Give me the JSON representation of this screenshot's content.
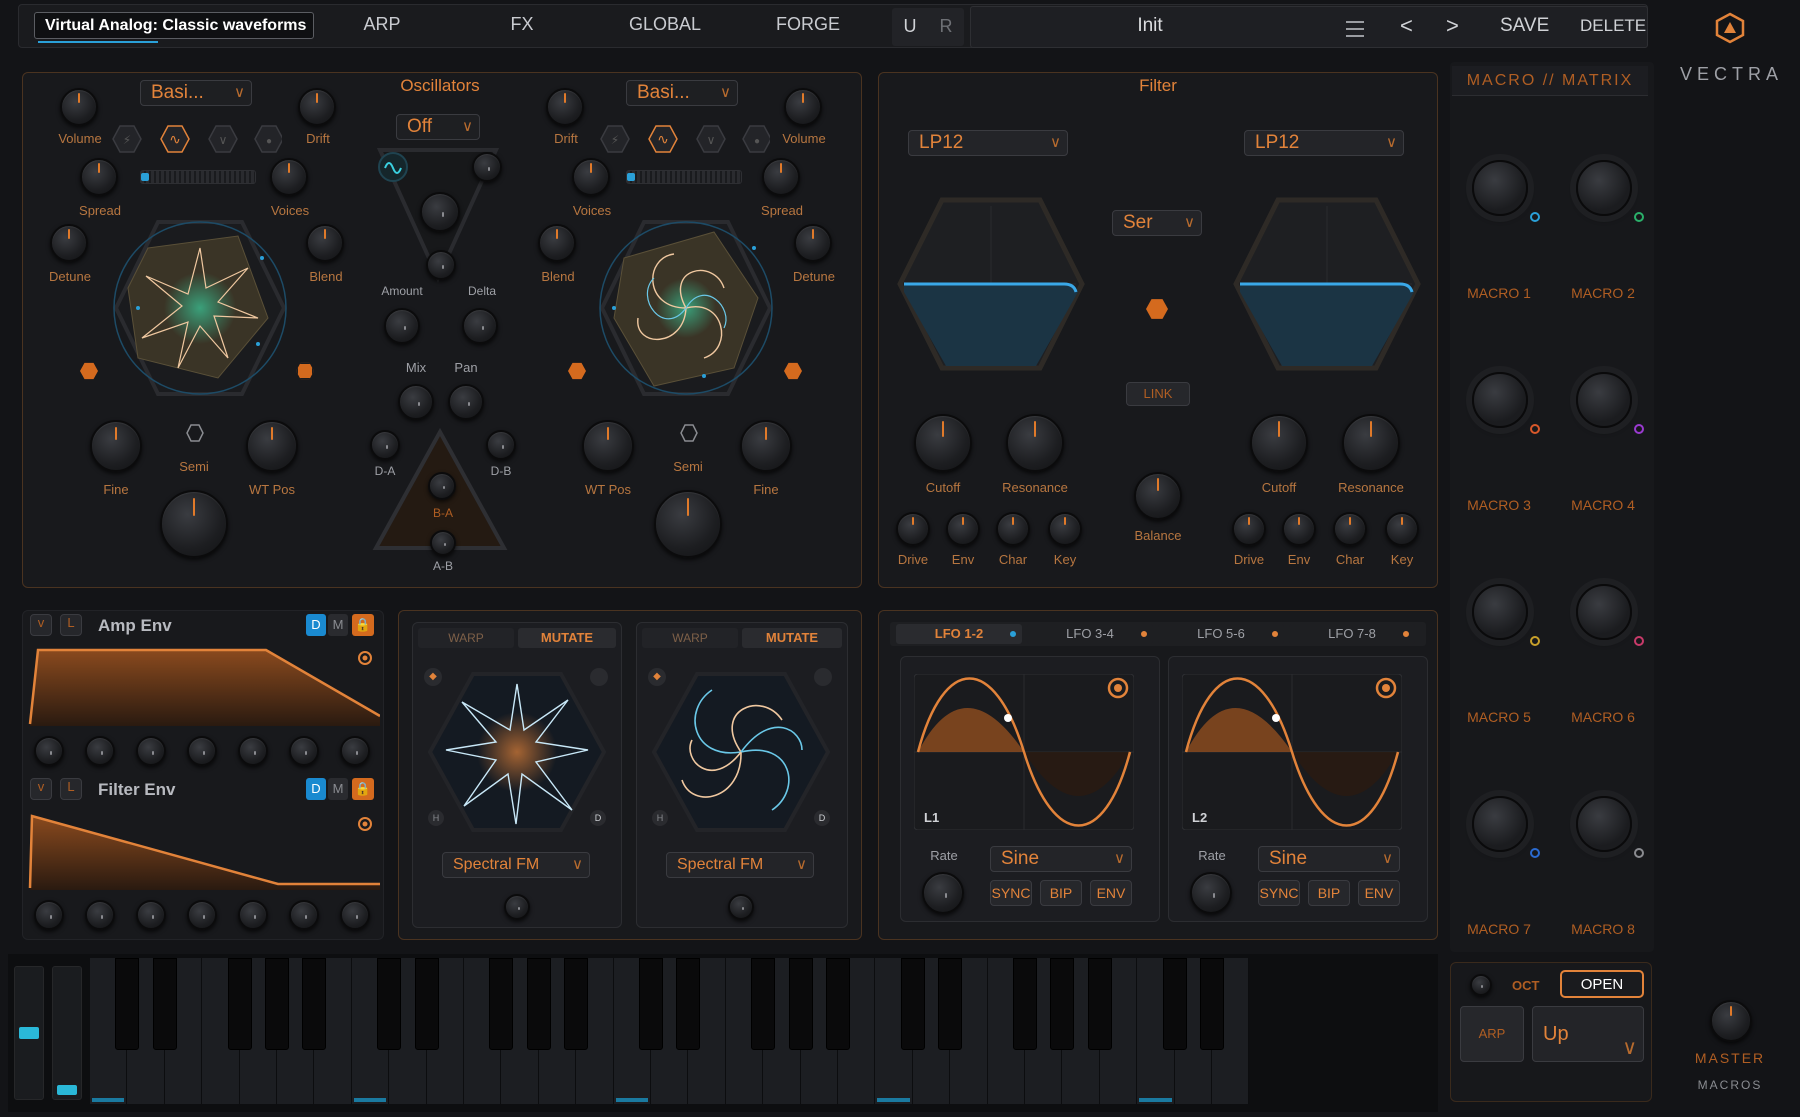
{
  "header": {
    "preset_category": "Virtual Analog: Classic waveforms",
    "tabs": [
      "ARP",
      "FX",
      "GLOBAL",
      "FORGE"
    ],
    "undo_label": "U",
    "redo_label": "R",
    "preset_name": "Init",
    "menu_icon": "hamburger-icon",
    "prev_label": "<",
    "next_label": ">",
    "save_label": "SAVE",
    "delete_label": "DELETE"
  },
  "brand": {
    "name": "VECTRA",
    "logo_icon": "vectra-hex-logo"
  },
  "oscillators": {
    "title": "Oscillators",
    "osc1": {
      "wave_select": "Basi...",
      "labels": {
        "volume": "Volume",
        "drift": "Drift",
        "spread": "Spread",
        "voices": "Voices",
        "detune": "Detune",
        "blend": "Blend",
        "fine": "Fine",
        "semi": "Semi",
        "wtpos": "WT Pos"
      }
    },
    "osc2": {
      "wave_select": "Basi...",
      "labels": {
        "volume": "Volume",
        "drift": "Drift",
        "spread": "Spread",
        "voices": "Voices",
        "detune": "Detune",
        "blend": "Blend",
        "fine": "Fine",
        "semi": "Semi",
        "wtpos": "WT Pos"
      }
    },
    "mod_select": "Off",
    "labels": {
      "amount": "Amount",
      "delta": "Delta",
      "mix": "Mix",
      "pan": "Pan",
      "da": "D-A",
      "db": "D-B",
      "ba": "B-A",
      "ab": "A-B"
    }
  },
  "filter": {
    "title": "Filter",
    "filter1_type": "LP12",
    "filter2_type": "LP12",
    "routing": "Ser",
    "link_label": "LINK",
    "balance_label": "Balance",
    "labels": {
      "cutoff": "Cutoff",
      "resonance": "Resonance",
      "drive": "Drive",
      "env": "Env",
      "char": "Char",
      "key": "Key"
    }
  },
  "macro_matrix": {
    "title": "MACRO // MATRIX",
    "macros": [
      {
        "label": "MACRO 1",
        "color": "#2aa0d8"
      },
      {
        "label": "MACRO 2",
        "color": "#2ab06a"
      },
      {
        "label": "MACRO 3",
        "color": "#d8582a"
      },
      {
        "label": "MACRO 4",
        "color": "#9a3ad0"
      },
      {
        "label": "MACRO 5",
        "color": "#c8a02a"
      },
      {
        "label": "MACRO 6",
        "color": "#c83a6a"
      },
      {
        "label": "MACRO 7",
        "color": "#2a6ad0"
      },
      {
        "label": "MACRO 8",
        "color": "#8a8b90"
      }
    ]
  },
  "envelopes": {
    "amp": {
      "v": "v",
      "l": "L",
      "title": "Amp Env",
      "d": "D",
      "m": "M"
    },
    "filter": {
      "v": "v",
      "l": "L",
      "title": "Filter Env",
      "d": "D",
      "m": "M"
    }
  },
  "warp": {
    "a": {
      "warp_label": "WARP",
      "mutate_label": "MUTATE",
      "mode": "Spectral FM",
      "h": "H",
      "d": "D"
    },
    "b": {
      "warp_label": "WARP",
      "mutate_label": "MUTATE",
      "mode": "Spectral FM",
      "h": "H",
      "d": "D"
    }
  },
  "lfo": {
    "tabs": [
      "LFO 1-2",
      "LFO 3-4",
      "LFO 5-6",
      "LFO 7-8"
    ],
    "active_tab": "LFO 1-2",
    "l1": {
      "name": "L1",
      "rate_label": "Rate",
      "shape": "Sine",
      "sync": "SYNC",
      "bip": "BIP",
      "env": "ENV"
    },
    "l2": {
      "name": "L2",
      "rate_label": "Rate",
      "shape": "Sine",
      "sync": "SYNC",
      "bip": "BIP",
      "env": "ENV"
    }
  },
  "bottom_right": {
    "oct_label": "OCT",
    "open_label": "OPEN",
    "arp_label": "ARP",
    "arp_mode": "Up",
    "master_label": "MASTER",
    "macros_label": "MACROS"
  },
  "colors": {
    "accent": "#e2833a",
    "accent_dark": "#b05e23",
    "blue": "#2aa0d8",
    "bg": "#131417"
  }
}
